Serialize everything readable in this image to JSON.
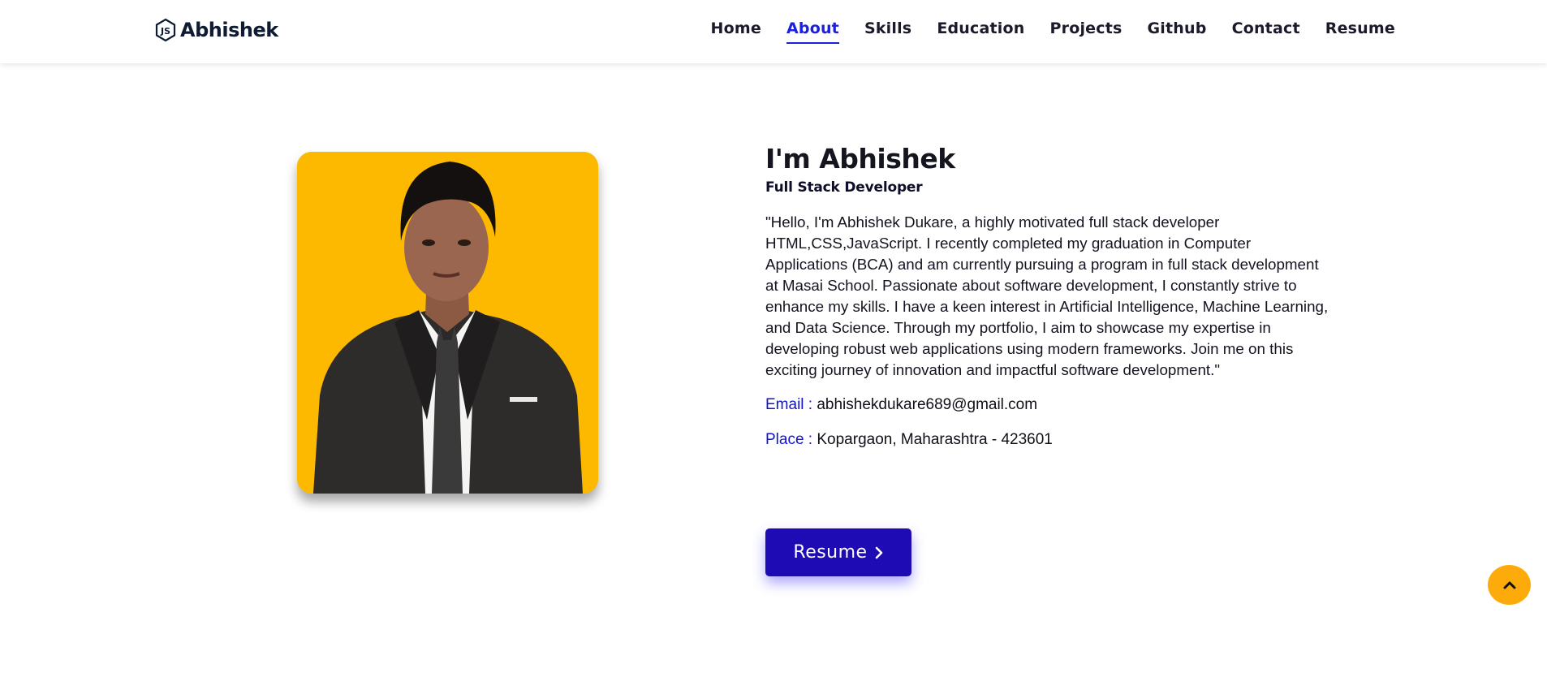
{
  "brand": {
    "name": "Abhishek",
    "icon": "nodejs-hexagon-icon"
  },
  "nav": {
    "items": [
      {
        "label": "Home"
      },
      {
        "label": "About",
        "active": true
      },
      {
        "label": "Skills"
      },
      {
        "label": "Education"
      },
      {
        "label": "Projects"
      },
      {
        "label": "Github"
      },
      {
        "label": "Contact"
      },
      {
        "label": "Resume"
      }
    ]
  },
  "about": {
    "heading": "I'm Abhishek",
    "role": "Full Stack Developer",
    "description": "\"Hello, I'm Abhishek Dukare, a highly motivated full stack developer HTML,CSS,JavaScript. I recently completed my graduation in Computer Applications (BCA) and am currently pursuing a program in full stack development at Masai School. Passionate about software development, I constantly strive to enhance my skills. I have a keen interest in Artificial Intelligence, Machine Learning, and Data Science. Through my portfolio, I aim to showcase my expertise in developing robust web applications using modern frameworks. Join me on this exciting journey of innovation and impactful software development.\"",
    "email_label": "Email :",
    "email": "abhishekdukare689@gmail.com",
    "place_label": "Place :",
    "place": "Kopargaon, Maharashtra - 423601",
    "resume_button": "Resume"
  },
  "colors": {
    "accent": "#1b20dd",
    "button": "#1f0bb3",
    "photo_background": "#fdb900",
    "scroll_top": "#fcab0b"
  },
  "icons": {
    "resume_chevron": "chevron-right-icon",
    "scroll_top": "chevron-up-icon"
  }
}
